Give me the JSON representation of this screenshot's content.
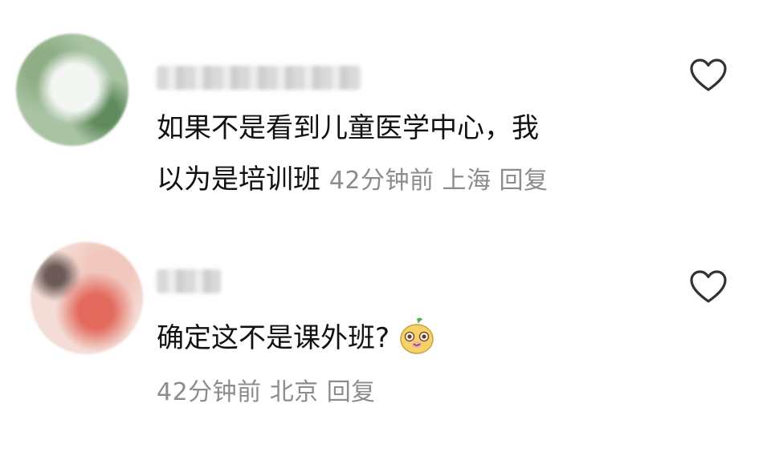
{
  "comments": [
    {
      "username": "",
      "line1": "如果不是看到儿童医学中心，我",
      "line2": "以为是培训班",
      "time": "42分钟前",
      "location": "上海",
      "reply": "回复",
      "like_icon": "heart-outline-icon"
    },
    {
      "username": "",
      "text": "确定这不是课外班?",
      "emoji": "smiling-face-emoji",
      "time": "42分钟前",
      "location": "北京",
      "reply": "回复",
      "like_icon": "heart-outline-icon"
    }
  ],
  "colors": {
    "text": "#111111",
    "meta": "#8c8c8c",
    "background": "#ffffff"
  }
}
